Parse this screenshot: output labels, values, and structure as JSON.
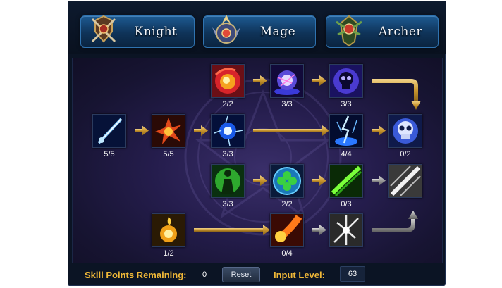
{
  "tabs": [
    {
      "label": "Knight",
      "icon": "knight-crest-icon"
    },
    {
      "label": "Mage",
      "icon": "mage-crest-icon"
    },
    {
      "label": "Archer",
      "icon": "archer-crest-icon"
    }
  ],
  "skills": {
    "fire_orb": {
      "level": "2/2",
      "icon": "fire-orb-icon"
    },
    "arcane_sphere": {
      "level": "3/3",
      "icon": "arcane-sphere-icon"
    },
    "dark_skull_aura": {
      "level": "3/3",
      "icon": "skull-aura-icon"
    },
    "ice_lance": {
      "level": "5/5",
      "icon": "ice-lance-icon"
    },
    "flame_burst": {
      "level": "5/5",
      "icon": "flame-burst-icon"
    },
    "lightning_nova": {
      "level": "3/3",
      "icon": "lightning-nova-icon"
    },
    "lightning_storm": {
      "level": "4/4",
      "icon": "lightning-storm-icon"
    },
    "death_skull": {
      "level": "0/2",
      "icon": "death-skull-icon"
    },
    "nature_aura": {
      "level": "3/3",
      "icon": "nature-aura-icon"
    },
    "clover_shield": {
      "level": "2/2",
      "icon": "clover-shield-icon"
    },
    "green_slash": {
      "level": "0/3",
      "icon": "green-slash-icon"
    },
    "silver_slash_locked": {
      "level": "",
      "icon": "silver-slash-icon"
    },
    "fire_potion": {
      "level": "1/2",
      "icon": "fire-potion-icon"
    },
    "meteor": {
      "level": "0/4",
      "icon": "meteor-icon"
    },
    "white_burst_locked": {
      "level": "",
      "icon": "white-burst-icon"
    }
  },
  "status": {
    "points_label": "Skill Points Remaining:",
    "points_value": "0",
    "reset_label": "Reset",
    "level_label": "Input Level:",
    "level_value": "63"
  },
  "colors": {
    "gold_arrow": "#d4a93c",
    "gray_arrow": "#9a9a9a",
    "label_gold": "#f0b838"
  }
}
